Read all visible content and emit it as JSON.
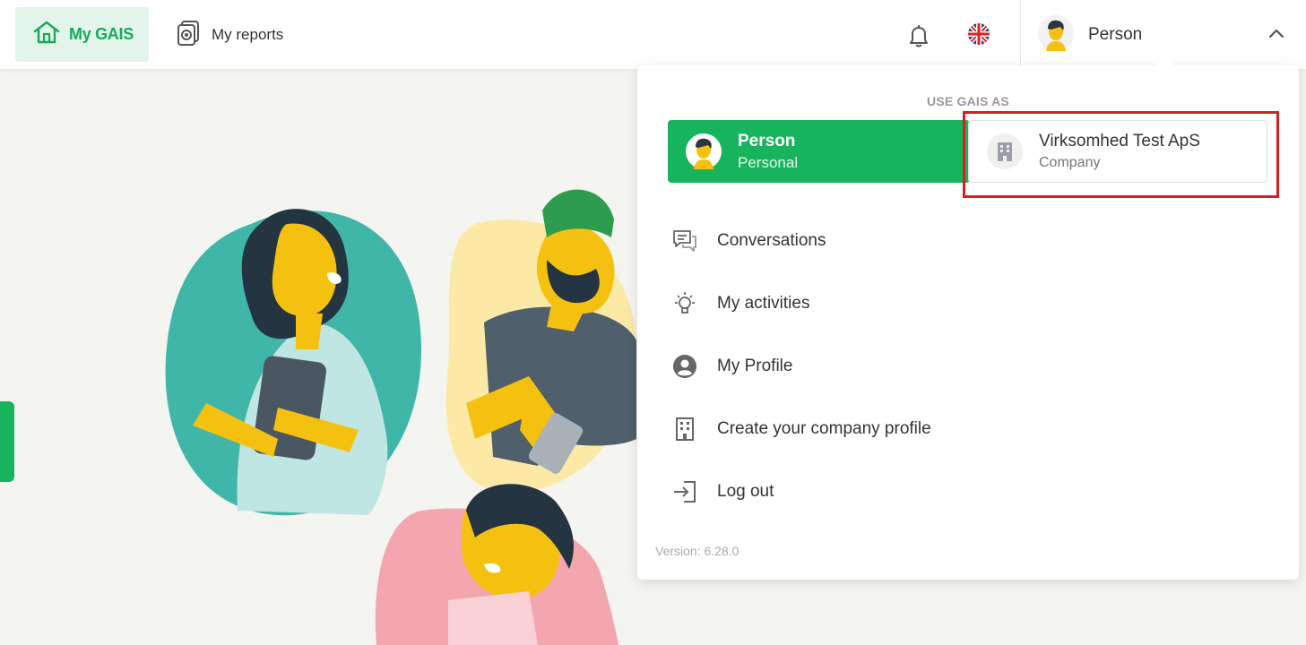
{
  "nav": {
    "home_label": "My GAIS",
    "reports_label": "My reports"
  },
  "header": {
    "user_name": "Person",
    "language": "English (UK)"
  },
  "dropdown": {
    "heading": "USE GAIS AS",
    "accounts": [
      {
        "name": "Person",
        "type": "Personal",
        "active": true
      },
      {
        "name": "Virksomhed Test ApS",
        "type": "Company",
        "active": false
      }
    ],
    "menu": [
      {
        "label": "Conversations",
        "icon": "chat-icon"
      },
      {
        "label": "My activities",
        "icon": "lightbulb-icon"
      },
      {
        "label": "My Profile",
        "icon": "profile-icon"
      },
      {
        "label": "Create your company profile",
        "icon": "building-icon"
      },
      {
        "label": "Log out",
        "icon": "logout-icon"
      }
    ],
    "version": "Version: 6.28.0"
  },
  "colors": {
    "brand_green": "#17b35d",
    "highlight_red": "#e01b1b"
  }
}
